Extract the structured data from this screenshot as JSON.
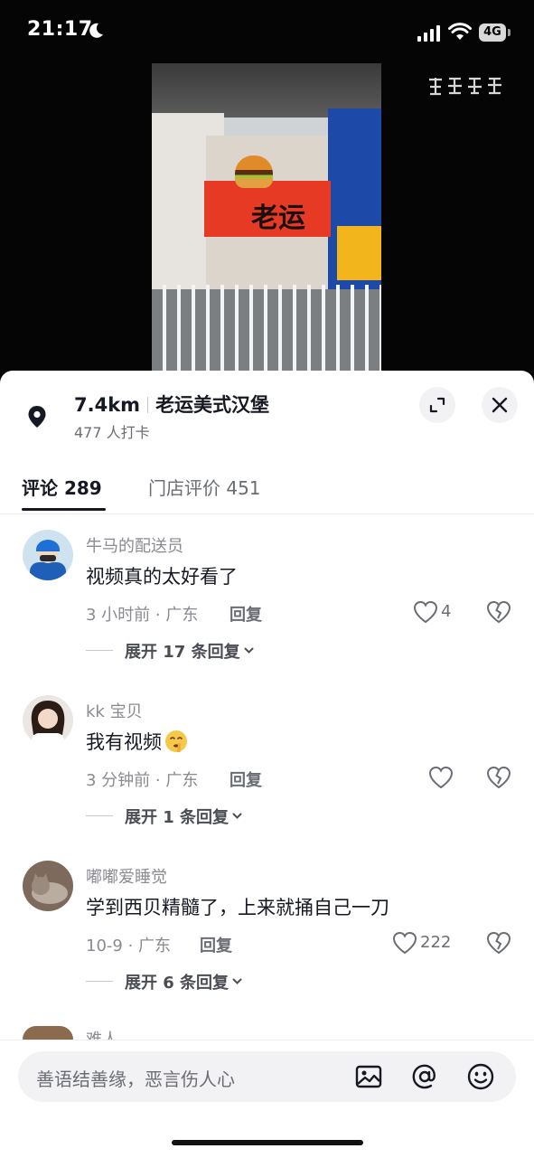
{
  "status_bar": {
    "time": "21:17",
    "battery_label": "4G"
  },
  "video": {
    "sign_text": "老运"
  },
  "location": {
    "distance": "7.4km",
    "name": "老运美式汉堡",
    "checkins": "477 人打卡"
  },
  "tabs": [
    {
      "label": "评论 289"
    },
    {
      "label": "门店评价 451"
    }
  ],
  "comments": [
    {
      "username": "牛马的配送员",
      "text": "视频真的太好看了",
      "meta": "3 小时前 · 广东",
      "reply_label": "回复",
      "likes": "4",
      "expand_label": "展开 17 条回复"
    },
    {
      "username": "kk 宝贝",
      "text": "我有视频",
      "meta": "3 分钟前 · 广东",
      "reply_label": "回复",
      "likes": "",
      "expand_label": "展开 1 条回复"
    },
    {
      "username": "嘟嘟爱睡觉",
      "text": "学到西贝精髓了，上来就捅自己一刀",
      "meta": "10-9 · 广东",
      "reply_label": "回复",
      "likes": "222",
      "expand_label": "展开 6 条回复"
    }
  ],
  "peek_comment": {
    "username": "难人"
  },
  "input": {
    "placeholder": "善语结善缘，恶言伤人心"
  },
  "colors": {
    "accent": "#161823",
    "muted": "#8a8b91",
    "sign_red": "#e63a24"
  }
}
